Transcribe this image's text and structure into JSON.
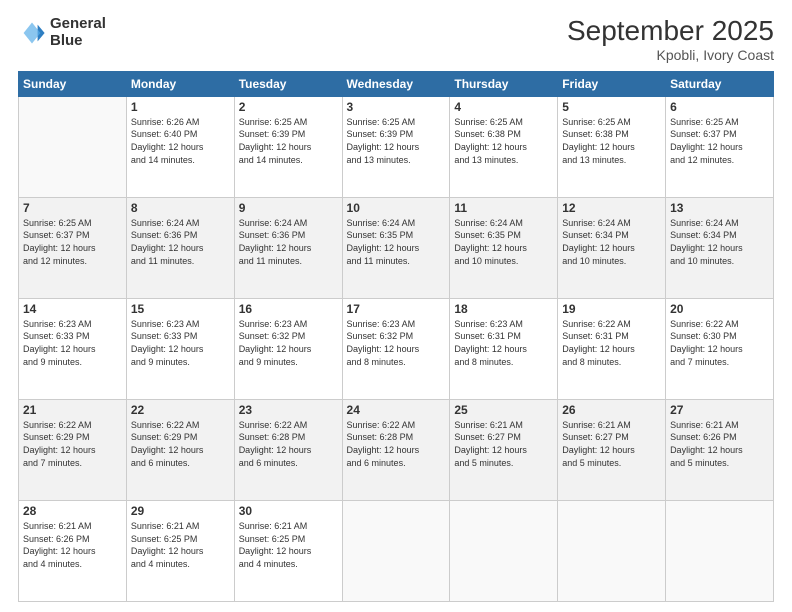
{
  "logo": {
    "line1": "General",
    "line2": "Blue"
  },
  "title": "September 2025",
  "subtitle": "Kpobli, Ivory Coast",
  "days_of_week": [
    "Sunday",
    "Monday",
    "Tuesday",
    "Wednesday",
    "Thursday",
    "Friday",
    "Saturday"
  ],
  "weeks": [
    [
      {
        "day": "",
        "info": ""
      },
      {
        "day": "1",
        "info": "Sunrise: 6:26 AM\nSunset: 6:40 PM\nDaylight: 12 hours\nand 14 minutes."
      },
      {
        "day": "2",
        "info": "Sunrise: 6:25 AM\nSunset: 6:39 PM\nDaylight: 12 hours\nand 14 minutes."
      },
      {
        "day": "3",
        "info": "Sunrise: 6:25 AM\nSunset: 6:39 PM\nDaylight: 12 hours\nand 13 minutes."
      },
      {
        "day": "4",
        "info": "Sunrise: 6:25 AM\nSunset: 6:38 PM\nDaylight: 12 hours\nand 13 minutes."
      },
      {
        "day": "5",
        "info": "Sunrise: 6:25 AM\nSunset: 6:38 PM\nDaylight: 12 hours\nand 13 minutes."
      },
      {
        "day": "6",
        "info": "Sunrise: 6:25 AM\nSunset: 6:37 PM\nDaylight: 12 hours\nand 12 minutes."
      }
    ],
    [
      {
        "day": "7",
        "info": "Sunrise: 6:25 AM\nSunset: 6:37 PM\nDaylight: 12 hours\nand 12 minutes."
      },
      {
        "day": "8",
        "info": "Sunrise: 6:24 AM\nSunset: 6:36 PM\nDaylight: 12 hours\nand 11 minutes."
      },
      {
        "day": "9",
        "info": "Sunrise: 6:24 AM\nSunset: 6:36 PM\nDaylight: 12 hours\nand 11 minutes."
      },
      {
        "day": "10",
        "info": "Sunrise: 6:24 AM\nSunset: 6:35 PM\nDaylight: 12 hours\nand 11 minutes."
      },
      {
        "day": "11",
        "info": "Sunrise: 6:24 AM\nSunset: 6:35 PM\nDaylight: 12 hours\nand 10 minutes."
      },
      {
        "day": "12",
        "info": "Sunrise: 6:24 AM\nSunset: 6:34 PM\nDaylight: 12 hours\nand 10 minutes."
      },
      {
        "day": "13",
        "info": "Sunrise: 6:24 AM\nSunset: 6:34 PM\nDaylight: 12 hours\nand 10 minutes."
      }
    ],
    [
      {
        "day": "14",
        "info": "Sunrise: 6:23 AM\nSunset: 6:33 PM\nDaylight: 12 hours\nand 9 minutes."
      },
      {
        "day": "15",
        "info": "Sunrise: 6:23 AM\nSunset: 6:33 PM\nDaylight: 12 hours\nand 9 minutes."
      },
      {
        "day": "16",
        "info": "Sunrise: 6:23 AM\nSunset: 6:32 PM\nDaylight: 12 hours\nand 9 minutes."
      },
      {
        "day": "17",
        "info": "Sunrise: 6:23 AM\nSunset: 6:32 PM\nDaylight: 12 hours\nand 8 minutes."
      },
      {
        "day": "18",
        "info": "Sunrise: 6:23 AM\nSunset: 6:31 PM\nDaylight: 12 hours\nand 8 minutes."
      },
      {
        "day": "19",
        "info": "Sunrise: 6:22 AM\nSunset: 6:31 PM\nDaylight: 12 hours\nand 8 minutes."
      },
      {
        "day": "20",
        "info": "Sunrise: 6:22 AM\nSunset: 6:30 PM\nDaylight: 12 hours\nand 7 minutes."
      }
    ],
    [
      {
        "day": "21",
        "info": "Sunrise: 6:22 AM\nSunset: 6:29 PM\nDaylight: 12 hours\nand 7 minutes."
      },
      {
        "day": "22",
        "info": "Sunrise: 6:22 AM\nSunset: 6:29 PM\nDaylight: 12 hours\nand 6 minutes."
      },
      {
        "day": "23",
        "info": "Sunrise: 6:22 AM\nSunset: 6:28 PM\nDaylight: 12 hours\nand 6 minutes."
      },
      {
        "day": "24",
        "info": "Sunrise: 6:22 AM\nSunset: 6:28 PM\nDaylight: 12 hours\nand 6 minutes."
      },
      {
        "day": "25",
        "info": "Sunrise: 6:21 AM\nSunset: 6:27 PM\nDaylight: 12 hours\nand 5 minutes."
      },
      {
        "day": "26",
        "info": "Sunrise: 6:21 AM\nSunset: 6:27 PM\nDaylight: 12 hours\nand 5 minutes."
      },
      {
        "day": "27",
        "info": "Sunrise: 6:21 AM\nSunset: 6:26 PM\nDaylight: 12 hours\nand 5 minutes."
      }
    ],
    [
      {
        "day": "28",
        "info": "Sunrise: 6:21 AM\nSunset: 6:26 PM\nDaylight: 12 hours\nand 4 minutes."
      },
      {
        "day": "29",
        "info": "Sunrise: 6:21 AM\nSunset: 6:25 PM\nDaylight: 12 hours\nand 4 minutes."
      },
      {
        "day": "30",
        "info": "Sunrise: 6:21 AM\nSunset: 6:25 PM\nDaylight: 12 hours\nand 4 minutes."
      },
      {
        "day": "",
        "info": ""
      },
      {
        "day": "",
        "info": ""
      },
      {
        "day": "",
        "info": ""
      },
      {
        "day": "",
        "info": ""
      }
    ]
  ],
  "row_colors": [
    "white",
    "shade",
    "white",
    "shade",
    "white"
  ]
}
